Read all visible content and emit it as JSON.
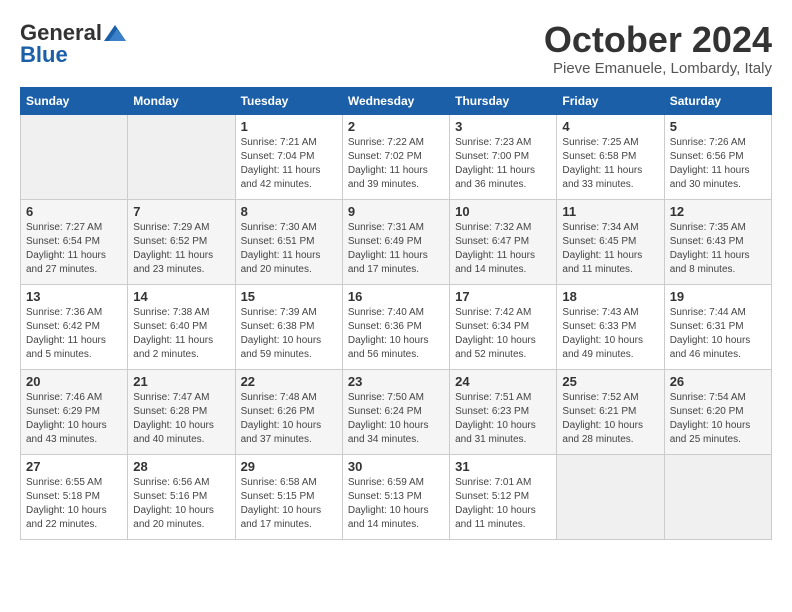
{
  "header": {
    "logo_line1": "General",
    "logo_line2": "Blue",
    "month": "October 2024",
    "location": "Pieve Emanuele, Lombardy, Italy"
  },
  "weekdays": [
    "Sunday",
    "Monday",
    "Tuesday",
    "Wednesday",
    "Thursday",
    "Friday",
    "Saturday"
  ],
  "weeks": [
    [
      {
        "day": "",
        "detail": ""
      },
      {
        "day": "",
        "detail": ""
      },
      {
        "day": "1",
        "detail": "Sunrise: 7:21 AM\nSunset: 7:04 PM\nDaylight: 11 hours and 42 minutes."
      },
      {
        "day": "2",
        "detail": "Sunrise: 7:22 AM\nSunset: 7:02 PM\nDaylight: 11 hours and 39 minutes."
      },
      {
        "day": "3",
        "detail": "Sunrise: 7:23 AM\nSunset: 7:00 PM\nDaylight: 11 hours and 36 minutes."
      },
      {
        "day": "4",
        "detail": "Sunrise: 7:25 AM\nSunset: 6:58 PM\nDaylight: 11 hours and 33 minutes."
      },
      {
        "day": "5",
        "detail": "Sunrise: 7:26 AM\nSunset: 6:56 PM\nDaylight: 11 hours and 30 minutes."
      }
    ],
    [
      {
        "day": "6",
        "detail": "Sunrise: 7:27 AM\nSunset: 6:54 PM\nDaylight: 11 hours and 27 minutes."
      },
      {
        "day": "7",
        "detail": "Sunrise: 7:29 AM\nSunset: 6:52 PM\nDaylight: 11 hours and 23 minutes."
      },
      {
        "day": "8",
        "detail": "Sunrise: 7:30 AM\nSunset: 6:51 PM\nDaylight: 11 hours and 20 minutes."
      },
      {
        "day": "9",
        "detail": "Sunrise: 7:31 AM\nSunset: 6:49 PM\nDaylight: 11 hours and 17 minutes."
      },
      {
        "day": "10",
        "detail": "Sunrise: 7:32 AM\nSunset: 6:47 PM\nDaylight: 11 hours and 14 minutes."
      },
      {
        "day": "11",
        "detail": "Sunrise: 7:34 AM\nSunset: 6:45 PM\nDaylight: 11 hours and 11 minutes."
      },
      {
        "day": "12",
        "detail": "Sunrise: 7:35 AM\nSunset: 6:43 PM\nDaylight: 11 hours and 8 minutes."
      }
    ],
    [
      {
        "day": "13",
        "detail": "Sunrise: 7:36 AM\nSunset: 6:42 PM\nDaylight: 11 hours and 5 minutes."
      },
      {
        "day": "14",
        "detail": "Sunrise: 7:38 AM\nSunset: 6:40 PM\nDaylight: 11 hours and 2 minutes."
      },
      {
        "day": "15",
        "detail": "Sunrise: 7:39 AM\nSunset: 6:38 PM\nDaylight: 10 hours and 59 minutes."
      },
      {
        "day": "16",
        "detail": "Sunrise: 7:40 AM\nSunset: 6:36 PM\nDaylight: 10 hours and 56 minutes."
      },
      {
        "day": "17",
        "detail": "Sunrise: 7:42 AM\nSunset: 6:34 PM\nDaylight: 10 hours and 52 minutes."
      },
      {
        "day": "18",
        "detail": "Sunrise: 7:43 AM\nSunset: 6:33 PM\nDaylight: 10 hours and 49 minutes."
      },
      {
        "day": "19",
        "detail": "Sunrise: 7:44 AM\nSunset: 6:31 PM\nDaylight: 10 hours and 46 minutes."
      }
    ],
    [
      {
        "day": "20",
        "detail": "Sunrise: 7:46 AM\nSunset: 6:29 PM\nDaylight: 10 hours and 43 minutes."
      },
      {
        "day": "21",
        "detail": "Sunrise: 7:47 AM\nSunset: 6:28 PM\nDaylight: 10 hours and 40 minutes."
      },
      {
        "day": "22",
        "detail": "Sunrise: 7:48 AM\nSunset: 6:26 PM\nDaylight: 10 hours and 37 minutes."
      },
      {
        "day": "23",
        "detail": "Sunrise: 7:50 AM\nSunset: 6:24 PM\nDaylight: 10 hours and 34 minutes."
      },
      {
        "day": "24",
        "detail": "Sunrise: 7:51 AM\nSunset: 6:23 PM\nDaylight: 10 hours and 31 minutes."
      },
      {
        "day": "25",
        "detail": "Sunrise: 7:52 AM\nSunset: 6:21 PM\nDaylight: 10 hours and 28 minutes."
      },
      {
        "day": "26",
        "detail": "Sunrise: 7:54 AM\nSunset: 6:20 PM\nDaylight: 10 hours and 25 minutes."
      }
    ],
    [
      {
        "day": "27",
        "detail": "Sunrise: 6:55 AM\nSunset: 5:18 PM\nDaylight: 10 hours and 22 minutes."
      },
      {
        "day": "28",
        "detail": "Sunrise: 6:56 AM\nSunset: 5:16 PM\nDaylight: 10 hours and 20 minutes."
      },
      {
        "day": "29",
        "detail": "Sunrise: 6:58 AM\nSunset: 5:15 PM\nDaylight: 10 hours and 17 minutes."
      },
      {
        "day": "30",
        "detail": "Sunrise: 6:59 AM\nSunset: 5:13 PM\nDaylight: 10 hours and 14 minutes."
      },
      {
        "day": "31",
        "detail": "Sunrise: 7:01 AM\nSunset: 5:12 PM\nDaylight: 10 hours and 11 minutes."
      },
      {
        "day": "",
        "detail": ""
      },
      {
        "day": "",
        "detail": ""
      }
    ]
  ]
}
